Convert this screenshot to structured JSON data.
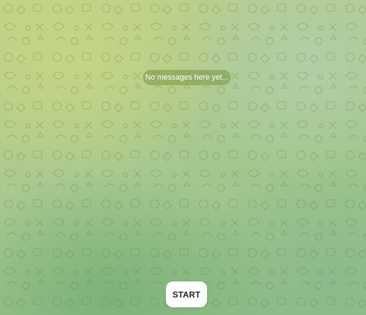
{
  "chat": {
    "empty_message": "No messages here yet...",
    "start_label": "START"
  },
  "theme": {
    "background_top_left": "#c2d186",
    "background_bottom": "#8fbc8a",
    "pill_color": "#78964699",
    "button_color": "#ffffff"
  }
}
